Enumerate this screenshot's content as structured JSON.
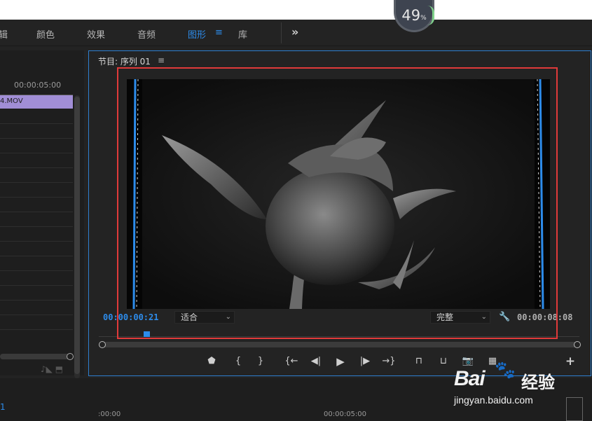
{
  "cpu_meter": {
    "value": "49",
    "unit": "%"
  },
  "workspaces": {
    "items": [
      {
        "label": "辑"
      },
      {
        "label": "颜色"
      },
      {
        "label": "效果"
      },
      {
        "label": "音频"
      },
      {
        "label": "图形"
      },
      {
        "label": "库"
      }
    ],
    "active": "图形",
    "menu_icon": "≡",
    "more_icon": "»"
  },
  "timeline_left": {
    "ruler_time": "00:00:05:00",
    "clip_name": "4.MOV"
  },
  "program_monitor": {
    "title": "节目: 序列 01",
    "menu_icon": "≡",
    "current_timecode": "00:00:00:21",
    "duration_timecode": "00:00:08:08",
    "zoom_select": "适合",
    "resolution_select": "完整",
    "transport": {
      "marker": "⬟",
      "mark_in": "{",
      "mark_out": "}",
      "go_to_in": "{←",
      "step_back": "◀|",
      "play": "▶",
      "step_forward": "|▶",
      "go_to_out": "→}",
      "lift": "⊓",
      "extract": "⊔",
      "camera": "📷",
      "compare": "▦",
      "add": "+"
    }
  },
  "timeline_bottom": {
    "sequence_label": "1",
    "time_start": ":00:00",
    "time_mid": "00:00:05:00"
  },
  "watermark": {
    "logo": "Bai",
    "cn": "经验",
    "url": "jingyan.baidu.com"
  },
  "colors": {
    "accent_blue": "#2d8ceb",
    "highlight_red": "#e03a3a",
    "clip_purple": "#a18ed6"
  }
}
